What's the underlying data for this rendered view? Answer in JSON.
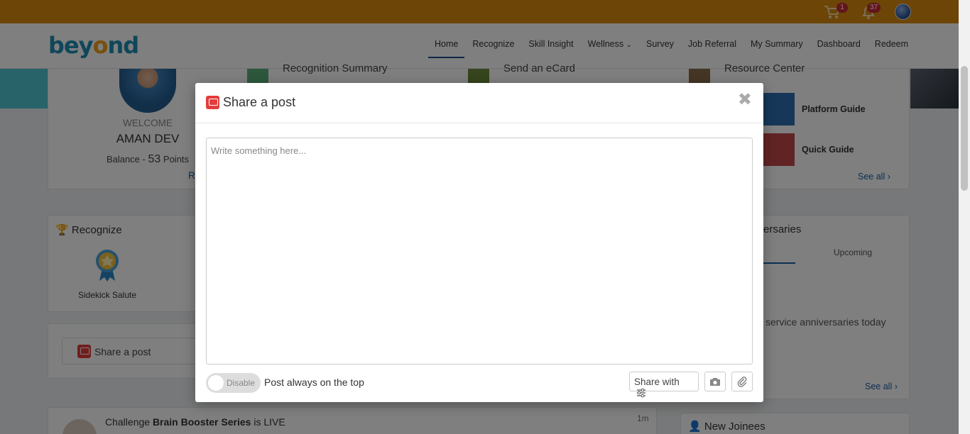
{
  "topbar": {
    "cart_count": "1",
    "notification_count": "37"
  },
  "nav": {
    "logo": "beyond",
    "items": [
      "Home",
      "Recognize",
      "Skill Insight",
      "Wellness",
      "Survey",
      "Job Referral",
      "My Summary",
      "Dashboard",
      "Redeem"
    ],
    "active": "Home"
  },
  "profile": {
    "welcome": "WELCOME",
    "name": "AMAN DEV",
    "balance_label": "Balance - ",
    "balance_value": "53",
    "balance_unit": "Points",
    "link_partial": "R"
  },
  "quick_links": {
    "recognition_summary": "Recognition Summary",
    "send_ecard": "Send an eCard",
    "resource_center": "Resource Center"
  },
  "resources": {
    "items": [
      "Platform Guide",
      "Quick Guide"
    ],
    "see_all": "See all ›"
  },
  "recognize_card": {
    "title": "Recognize",
    "badge_label": "Sidekick Salute"
  },
  "share_card": {
    "label": "Share a post"
  },
  "anniversaries": {
    "title_partial": "ersaries",
    "tab_upcoming": "Upcoming",
    "empty": "service anniversaries today",
    "see_all": "See all ›"
  },
  "feed": {
    "prefix": "Challenge ",
    "bold": "Brain Booster Series",
    "suffix": " is LIVE",
    "time": "1m"
  },
  "joinees": {
    "title": "New Joinees"
  },
  "modal": {
    "title": "Share a post",
    "placeholder": "Write something here...",
    "toggle_label": "Disable",
    "toggle_text": "Post always on the top",
    "share_with": "Share with"
  }
}
